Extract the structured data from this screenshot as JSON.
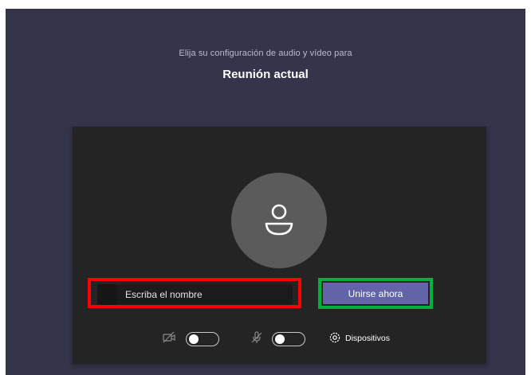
{
  "header": {
    "subtitle": "Elija su configuración de audio y vídeo para",
    "meeting_title": "Reunión actual"
  },
  "form": {
    "name_placeholder": "Escriba el nombre",
    "join_label": "Unirse ahora"
  },
  "controls": {
    "camera_toggle_on": false,
    "mic_toggle_on": false,
    "devices_label": "Dispositivos"
  },
  "colors": {
    "background": "#34344a",
    "card": "#242424",
    "accent": "#6264a7",
    "name_highlight": "#ff0000",
    "join_highlight": "#00b03a"
  },
  "icons": {
    "avatar": "person-icon",
    "camera": "camera-off-icon",
    "mic": "mic-off-icon",
    "devices": "gear-icon"
  }
}
